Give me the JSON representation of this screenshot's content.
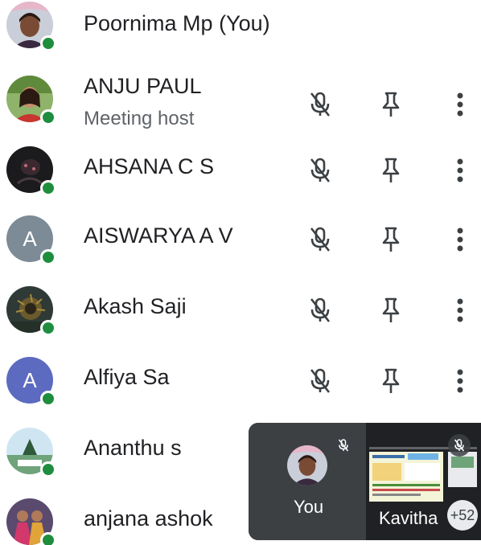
{
  "participants": [
    {
      "name": "Poornima Mp (You)",
      "subtitle": "",
      "avatar": "photo",
      "has_controls": false
    },
    {
      "name": "ANJU PAUL",
      "subtitle": "Meeting host",
      "avatar": "photo",
      "has_controls": true
    },
    {
      "name": "AHSANA C S",
      "subtitle": "",
      "avatar": "photo",
      "has_controls": true
    },
    {
      "name": "AISWARYA A V",
      "subtitle": "",
      "avatar": "letter",
      "letter": "A",
      "has_controls": true
    },
    {
      "name": "Akash Saji",
      "subtitle": "",
      "avatar": "photo",
      "has_controls": true
    },
    {
      "name": "Alfiya Sa",
      "subtitle": "",
      "avatar": "letter",
      "letter": "A",
      "has_controls": true
    },
    {
      "name": "Ananthu s",
      "subtitle": "",
      "avatar": "photo",
      "has_controls": false
    },
    {
      "name": "anjana ashok",
      "subtitle": "",
      "avatar": "photo",
      "has_controls": false
    }
  ],
  "icons": {
    "mute": "mic-off-icon",
    "pin": "pin-icon",
    "more": "more-vert-icon",
    "status": "online-status-icon"
  },
  "pip": {
    "self_label": "You",
    "share_label": "Kavitha",
    "more_count": "+52"
  },
  "colors": {
    "online": "#1e8e3e",
    "icon": "#3c4043",
    "text": "#202124",
    "subtext": "#5f6368",
    "letter_avatar_grey": "#7c8b96",
    "letter_avatar_blue": "#5c6bc0",
    "pip_background": "#3c4043"
  }
}
